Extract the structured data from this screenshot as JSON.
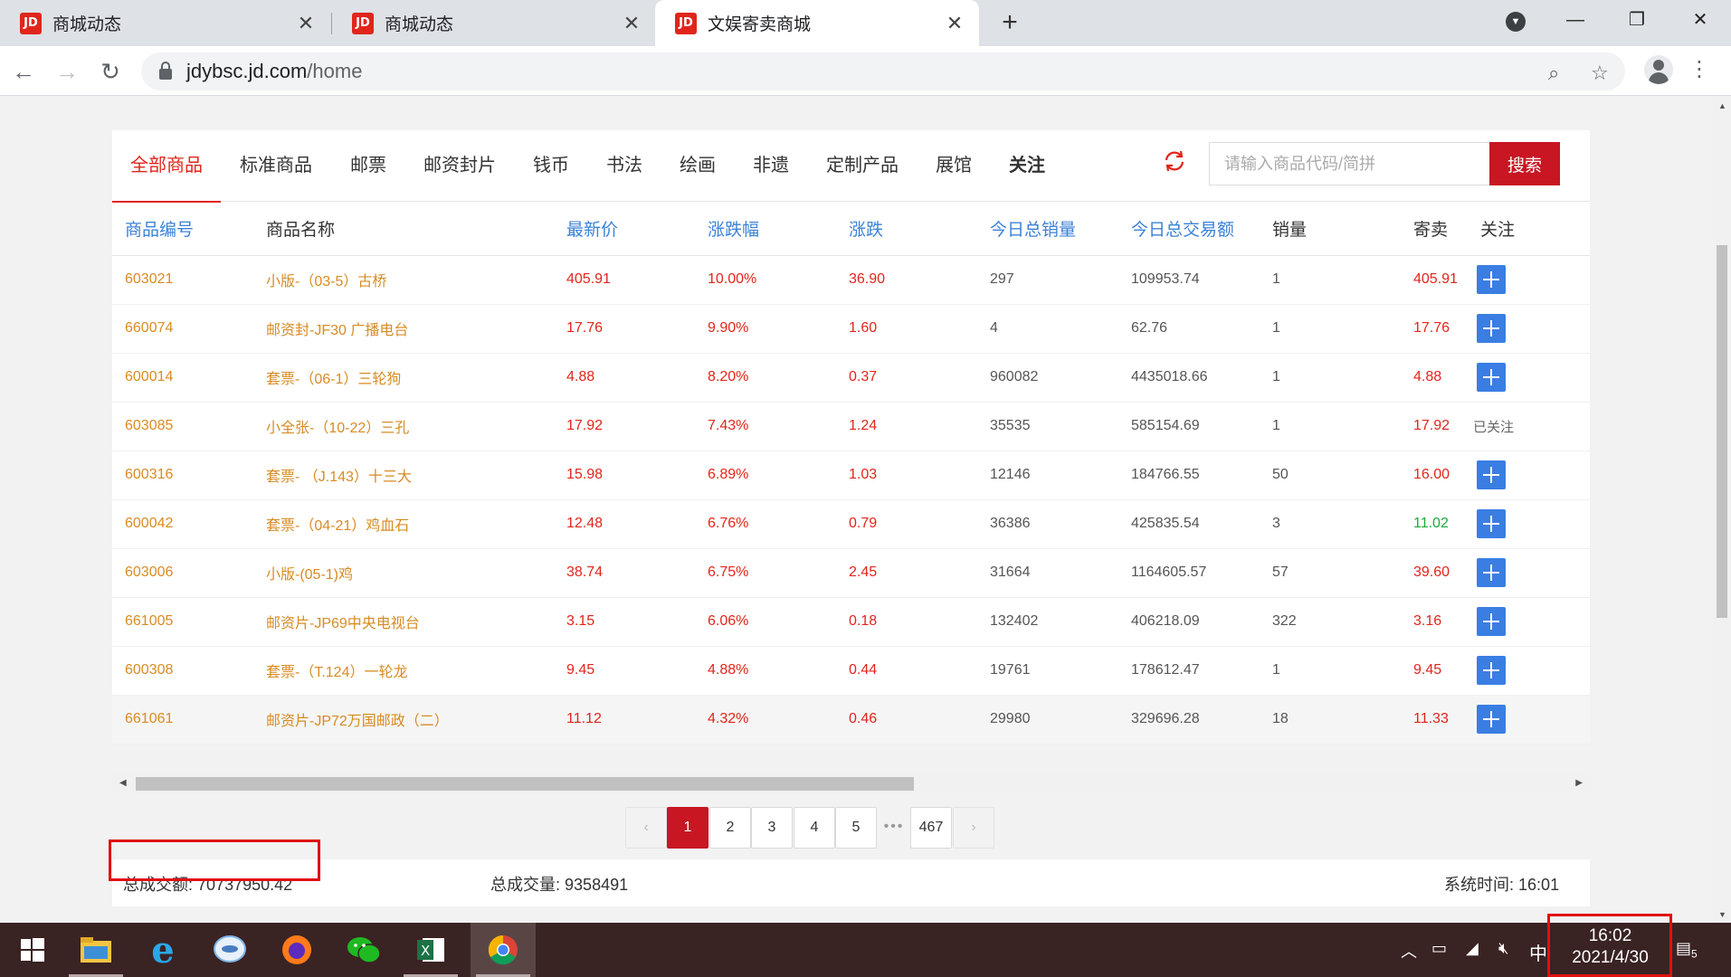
{
  "browser": {
    "tabs": [
      {
        "title": "商城动态",
        "favicon": "JD"
      },
      {
        "title": "商城动态",
        "favicon": "JD"
      },
      {
        "title": "文娱寄卖商城",
        "favicon": "JD"
      }
    ],
    "url_host": "jdybsc.jd.com",
    "url_path": "/home"
  },
  "categories": [
    "全部商品",
    "标准商品",
    "邮票",
    "邮资封片",
    "钱币",
    "书法",
    "绘画",
    "非遗",
    "定制产品",
    "展馆",
    "关注"
  ],
  "search": {
    "placeholder": "请输入商品代码/简拼",
    "button": "搜索"
  },
  "table": {
    "headers": [
      "商品编号",
      "商品名称",
      "最新价",
      "涨跌幅",
      "涨跌",
      "今日总销量",
      "今日总交易额",
      "销量",
      "寄卖",
      "关注"
    ],
    "rows": [
      {
        "code": "603021",
        "name": "小版-（03-5）古桥",
        "price": "405.91",
        "pct": "10.00%",
        "chg": "36.90",
        "vol": "297",
        "amt": "109953.74",
        "sales": "1",
        "consign": "405.91",
        "consign_color": "red",
        "followed": false
      },
      {
        "code": "660074",
        "name": "邮资封-JF30 广播电台",
        "price": "17.76",
        "pct": "9.90%",
        "chg": "1.60",
        "vol": "4",
        "amt": "62.76",
        "sales": "1",
        "consign": "17.76",
        "consign_color": "red",
        "followed": false
      },
      {
        "code": "600014",
        "name": "套票-（06-1）三轮狗",
        "price": "4.88",
        "pct": "8.20%",
        "chg": "0.37",
        "vol": "960082",
        "amt": "4435018.66",
        "sales": "1",
        "consign": "4.88",
        "consign_color": "red",
        "followed": false
      },
      {
        "code": "603085",
        "name": "小全张-（10-22）三孔",
        "price": "17.92",
        "pct": "7.43%",
        "chg": "1.24",
        "vol": "35535",
        "amt": "585154.69",
        "sales": "1",
        "consign": "17.92",
        "consign_color": "red",
        "followed": true
      },
      {
        "code": "600316",
        "name": "套票- （J.143）十三大",
        "price": "15.98",
        "pct": "6.89%",
        "chg": "1.03",
        "vol": "12146",
        "amt": "184766.55",
        "sales": "50",
        "consign": "16.00",
        "consign_color": "red",
        "followed": false
      },
      {
        "code": "600042",
        "name": "套票-（04-21）鸡血石",
        "price": "12.48",
        "pct": "6.76%",
        "chg": "0.79",
        "vol": "36386",
        "amt": "425835.54",
        "sales": "3",
        "consign": "11.02",
        "consign_color": "green",
        "followed": false
      },
      {
        "code": "603006",
        "name": "小版-(05-1)鸡",
        "price": "38.74",
        "pct": "6.75%",
        "chg": "2.45",
        "vol": "31664",
        "amt": "1164605.57",
        "sales": "57",
        "consign": "39.60",
        "consign_color": "red",
        "followed": false
      },
      {
        "code": "661005",
        "name": "邮资片-JP69中央电视台",
        "price": "3.15",
        "pct": "6.06%",
        "chg": "0.18",
        "vol": "132402",
        "amt": "406218.09",
        "sales": "322",
        "consign": "3.16",
        "consign_color": "red",
        "followed": false
      },
      {
        "code": "600308",
        "name": "套票-（T.124）一轮龙",
        "price": "9.45",
        "pct": "4.88%",
        "chg": "0.44",
        "vol": "19761",
        "amt": "178612.47",
        "sales": "1",
        "consign": "9.45",
        "consign_color": "red",
        "followed": false
      },
      {
        "code": "661061",
        "name": "邮资片-JP72万国邮政（二）",
        "price": "11.12",
        "pct": "4.32%",
        "chg": "0.46",
        "vol": "29980",
        "amt": "329696.28",
        "sales": "18",
        "consign": "11.33",
        "consign_color": "red",
        "followed": false
      }
    ],
    "followed_label": "已关注"
  },
  "pager": {
    "prev": "‹",
    "pages": [
      "1",
      "2",
      "3",
      "4",
      "5"
    ],
    "dots": "•••",
    "last": "467",
    "next": "›",
    "current": "1"
  },
  "footer": {
    "total_amount_label": "总成交额:",
    "total_amount": "70737950.42",
    "total_volume_label": "总成交量:",
    "total_volume": "9358491",
    "sys_time_label": "系统时间:",
    "sys_time": "16:01"
  },
  "taskbar": {
    "clock_time": "16:02",
    "clock_date": "2021/4/30",
    "ime": "中",
    "notif_count": "5"
  },
  "colors": {
    "accent_red": "#e1251b",
    "search_red": "#c81623",
    "header_blue": "#3d82d7",
    "orange_text": "#d88b23",
    "plus_blue": "#3a7ee3",
    "taskbar": "#3a2323"
  }
}
